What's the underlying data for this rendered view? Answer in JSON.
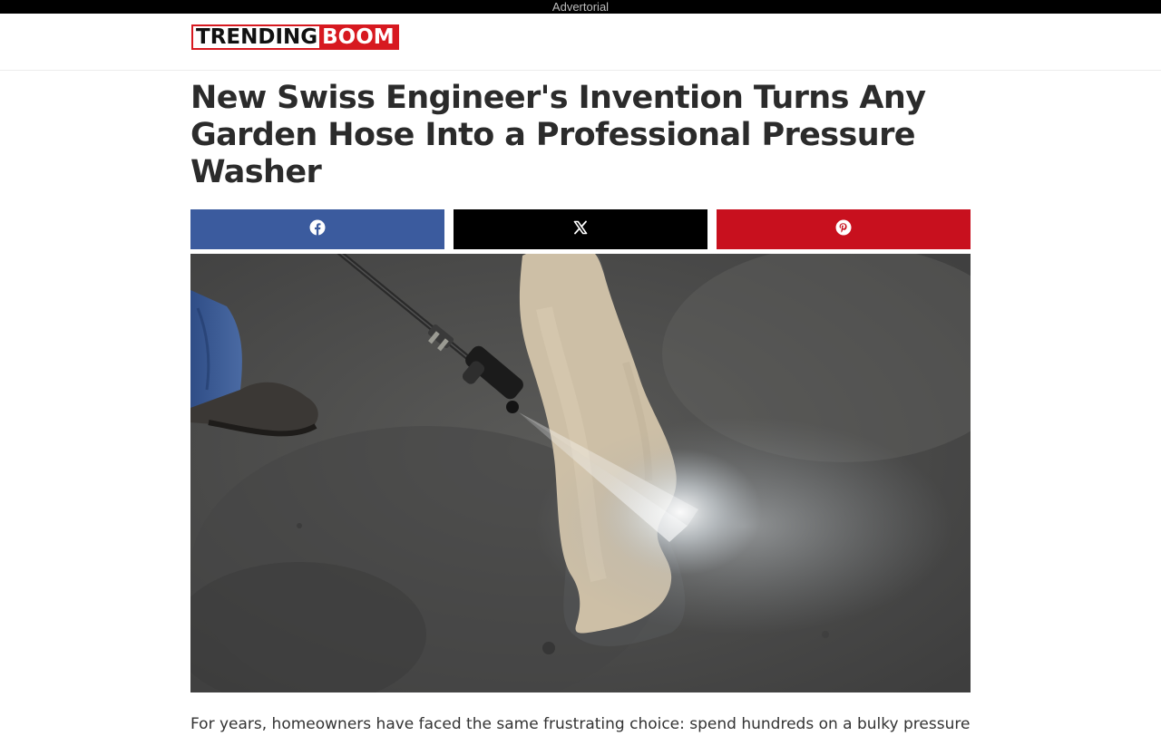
{
  "ad_bar": {
    "label": "Advertorial"
  },
  "header": {
    "logo": {
      "part1": "TRENDING",
      "part2": "BOOM"
    }
  },
  "article": {
    "title": "New Swiss Engineer's Invention Turns Any Garden Hose Into a Professional Pressure Washer",
    "share_buttons": [
      {
        "network": "Facebook",
        "icon": "facebook-icon",
        "color": "#3b5b9e"
      },
      {
        "network": "X",
        "icon": "x-icon",
        "color": "#000000"
      },
      {
        "network": "Pinterest",
        "icon": "pinterest-icon",
        "color": "#c8101e"
      }
    ],
    "body_first_line": "For years, homeowners have faced the same frustrating choice: spend hundreds on a bulky pressure"
  },
  "colors": {
    "brand_red": "#d71920",
    "headline_text": "#2b2b2b"
  }
}
